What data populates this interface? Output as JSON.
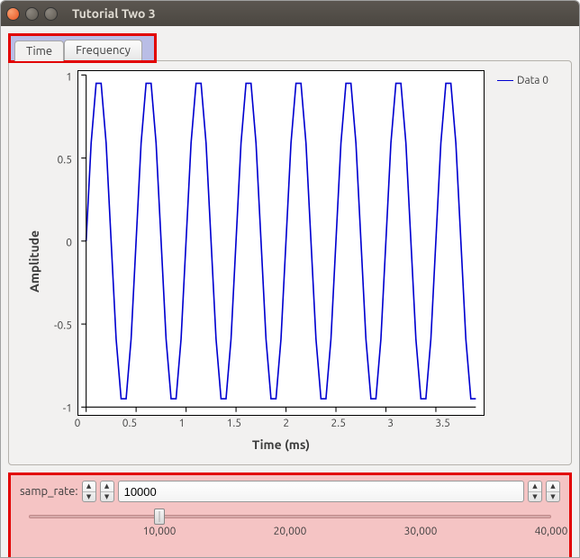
{
  "window": {
    "title": "Tutorial Two 3"
  },
  "tabs": {
    "items": [
      {
        "label": "Time",
        "active": true
      },
      {
        "label": "Frequency",
        "active": false
      }
    ]
  },
  "legend": {
    "series0": "Data 0",
    "color": "#0000d0"
  },
  "axes": {
    "ylabel": "Amplitude",
    "xlabel": "Time (ms)",
    "yticks": [
      "1",
      "0.5",
      "0",
      "-0.5",
      "-1"
    ],
    "xticks": [
      "0",
      "0.5",
      "1",
      "1.5",
      "2",
      "2.5",
      "3",
      "3.5"
    ]
  },
  "samp_rate": {
    "label": "samp_rate:",
    "value": "10000",
    "slider_ticks": [
      "10,000",
      "20,000",
      "30,000",
      "40,000"
    ],
    "slider_min": 0,
    "slider_max": 40000,
    "slider_pos_pct": 25
  },
  "chart_data": {
    "type": "line",
    "title": "",
    "xlabel": "Time (ms)",
    "ylabel": "Amplitude",
    "xlim": [
      0,
      3.9
    ],
    "ylim": [
      -1,
      1
    ],
    "series": [
      {
        "name": "Data 0",
        "color": "#0000d0",
        "x": [
          0.0,
          0.05,
          0.1,
          0.15,
          0.2,
          0.25,
          0.3,
          0.35,
          0.4,
          0.45,
          0.5,
          0.55,
          0.6,
          0.65,
          0.7,
          0.75,
          0.8,
          0.85,
          0.9,
          0.95,
          1.0,
          1.05,
          1.1,
          1.15,
          1.2,
          1.25,
          1.3,
          1.35,
          1.4,
          1.45,
          1.5,
          1.55,
          1.6,
          1.65,
          1.7,
          1.75,
          1.8,
          1.85,
          1.9,
          1.95,
          2.0,
          2.05,
          2.1,
          2.15,
          2.2,
          2.25,
          2.3,
          2.35,
          2.4,
          2.45,
          2.5,
          2.55,
          2.6,
          2.65,
          2.7,
          2.75,
          2.8,
          2.85,
          2.9,
          2.95,
          3.0,
          3.05,
          3.1,
          3.15,
          3.2,
          3.25,
          3.3,
          3.35,
          3.4,
          3.45,
          3.5,
          3.55,
          3.6,
          3.65,
          3.7,
          3.75,
          3.8,
          3.85,
          3.9
        ],
        "y": [
          0.0,
          0.59,
          0.95,
          0.95,
          0.59,
          0.0,
          -0.59,
          -0.95,
          -0.95,
          -0.59,
          0.0,
          0.59,
          0.95,
          0.95,
          0.59,
          0.0,
          -0.59,
          -0.95,
          -0.95,
          -0.59,
          0.0,
          0.59,
          0.95,
          0.95,
          0.59,
          0.0,
          -0.59,
          -0.95,
          -0.95,
          -0.59,
          0.0,
          0.59,
          0.95,
          0.95,
          0.59,
          0.0,
          -0.59,
          -0.95,
          -0.95,
          -0.59,
          0.0,
          0.59,
          0.95,
          0.95,
          0.59,
          0.0,
          -0.59,
          -0.95,
          -0.95,
          -0.59,
          0.0,
          0.59,
          0.95,
          0.95,
          0.59,
          0.0,
          -0.59,
          -0.95,
          -0.95,
          -0.59,
          0.0,
          0.59,
          0.95,
          0.95,
          0.59,
          0.0,
          -0.59,
          -0.95,
          -0.95,
          -0.59,
          0.0,
          0.59,
          0.95,
          0.95,
          0.59,
          0.0,
          -0.59,
          -0.95,
          -0.95
        ]
      }
    ]
  }
}
